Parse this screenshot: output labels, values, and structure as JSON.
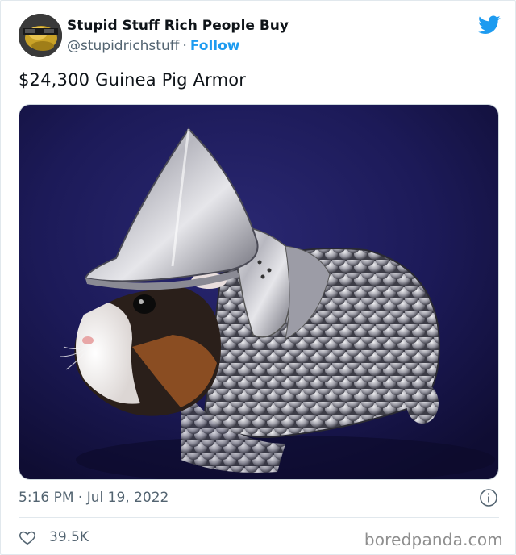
{
  "account": {
    "display_name": "Stupid Stuff Rich People Buy",
    "handle": "@stupidrichstuff",
    "separator": "·",
    "follow_label": "Follow"
  },
  "tweet": {
    "text": "$24,300 Guinea Pig Armor",
    "time": "5:16 PM",
    "separator": "·",
    "date": "Jul 19, 2022",
    "like_count": "39.5K"
  },
  "watermark": "boredpanda.com",
  "icons": {
    "brand": "twitter-bird-icon",
    "info": "info-icon",
    "like": "heart-icon"
  },
  "colors": {
    "accent": "#1d9bf0",
    "text_primary": "#0f1419",
    "text_secondary": "#536471",
    "photo_background": "#1a1650"
  }
}
